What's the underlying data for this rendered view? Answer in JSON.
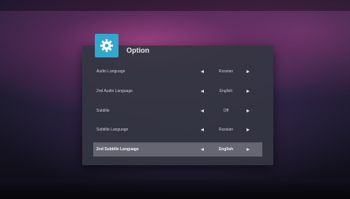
{
  "dialog": {
    "title": "Option",
    "icon": "gear-icon",
    "accent_color": "#33a7cc"
  },
  "options": [
    {
      "label": "Audio Language",
      "value": "Russian",
      "selected": false
    },
    {
      "label": "2nd Audio Language",
      "value": "English",
      "selected": false
    },
    {
      "label": "Subtitle",
      "value": "Off",
      "selected": false
    },
    {
      "label": "Subtitle Language",
      "value": "Russian",
      "selected": false
    },
    {
      "label": "2nd Subtitle Language",
      "value": "English",
      "selected": true
    }
  ]
}
